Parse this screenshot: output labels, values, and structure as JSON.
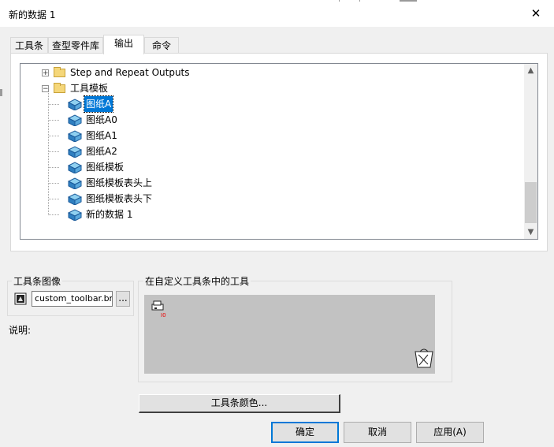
{
  "window": {
    "title": "新的数据 1",
    "close_glyph": "✕"
  },
  "tabs": [
    {
      "label": "工具条",
      "active": false
    },
    {
      "label": "查型零件库",
      "active": false
    },
    {
      "label": "输出",
      "active": true
    },
    {
      "label": "命令",
      "active": false
    }
  ],
  "tree": {
    "nodes": [
      {
        "label": "Step and Repeat Outputs",
        "type": "folder",
        "expander": "+"
      },
      {
        "label": "工具模板",
        "type": "folder",
        "expander": "−"
      },
      {
        "label": "图纸A",
        "type": "item",
        "selected": true
      },
      {
        "label": "图纸A0",
        "type": "item"
      },
      {
        "label": "图纸A1",
        "type": "item"
      },
      {
        "label": "图纸A2",
        "type": "item"
      },
      {
        "label": "图纸模板",
        "type": "item"
      },
      {
        "label": "图纸模板表头上",
        "type": "item"
      },
      {
        "label": "图纸模板表头下",
        "type": "item"
      },
      {
        "label": "新的数据 1",
        "type": "item"
      }
    ],
    "scroll_up": "▲",
    "scroll_down": "▼"
  },
  "toolbar_image": {
    "group_label": "工具条图像",
    "filename": "custom_toolbar.bmp",
    "browse_label": "..."
  },
  "description_label": "说明:",
  "custom_tools": {
    "group_label": "在自定义工具条中的工具"
  },
  "buttons": {
    "toolbar_color": "工具条颜色...",
    "ok": "确定",
    "cancel": "取消",
    "apply": "应用(A)"
  },
  "colors": {
    "accent": "#0078d7",
    "tool_area": "#c2c2c2",
    "folder": "#f5d77a"
  }
}
